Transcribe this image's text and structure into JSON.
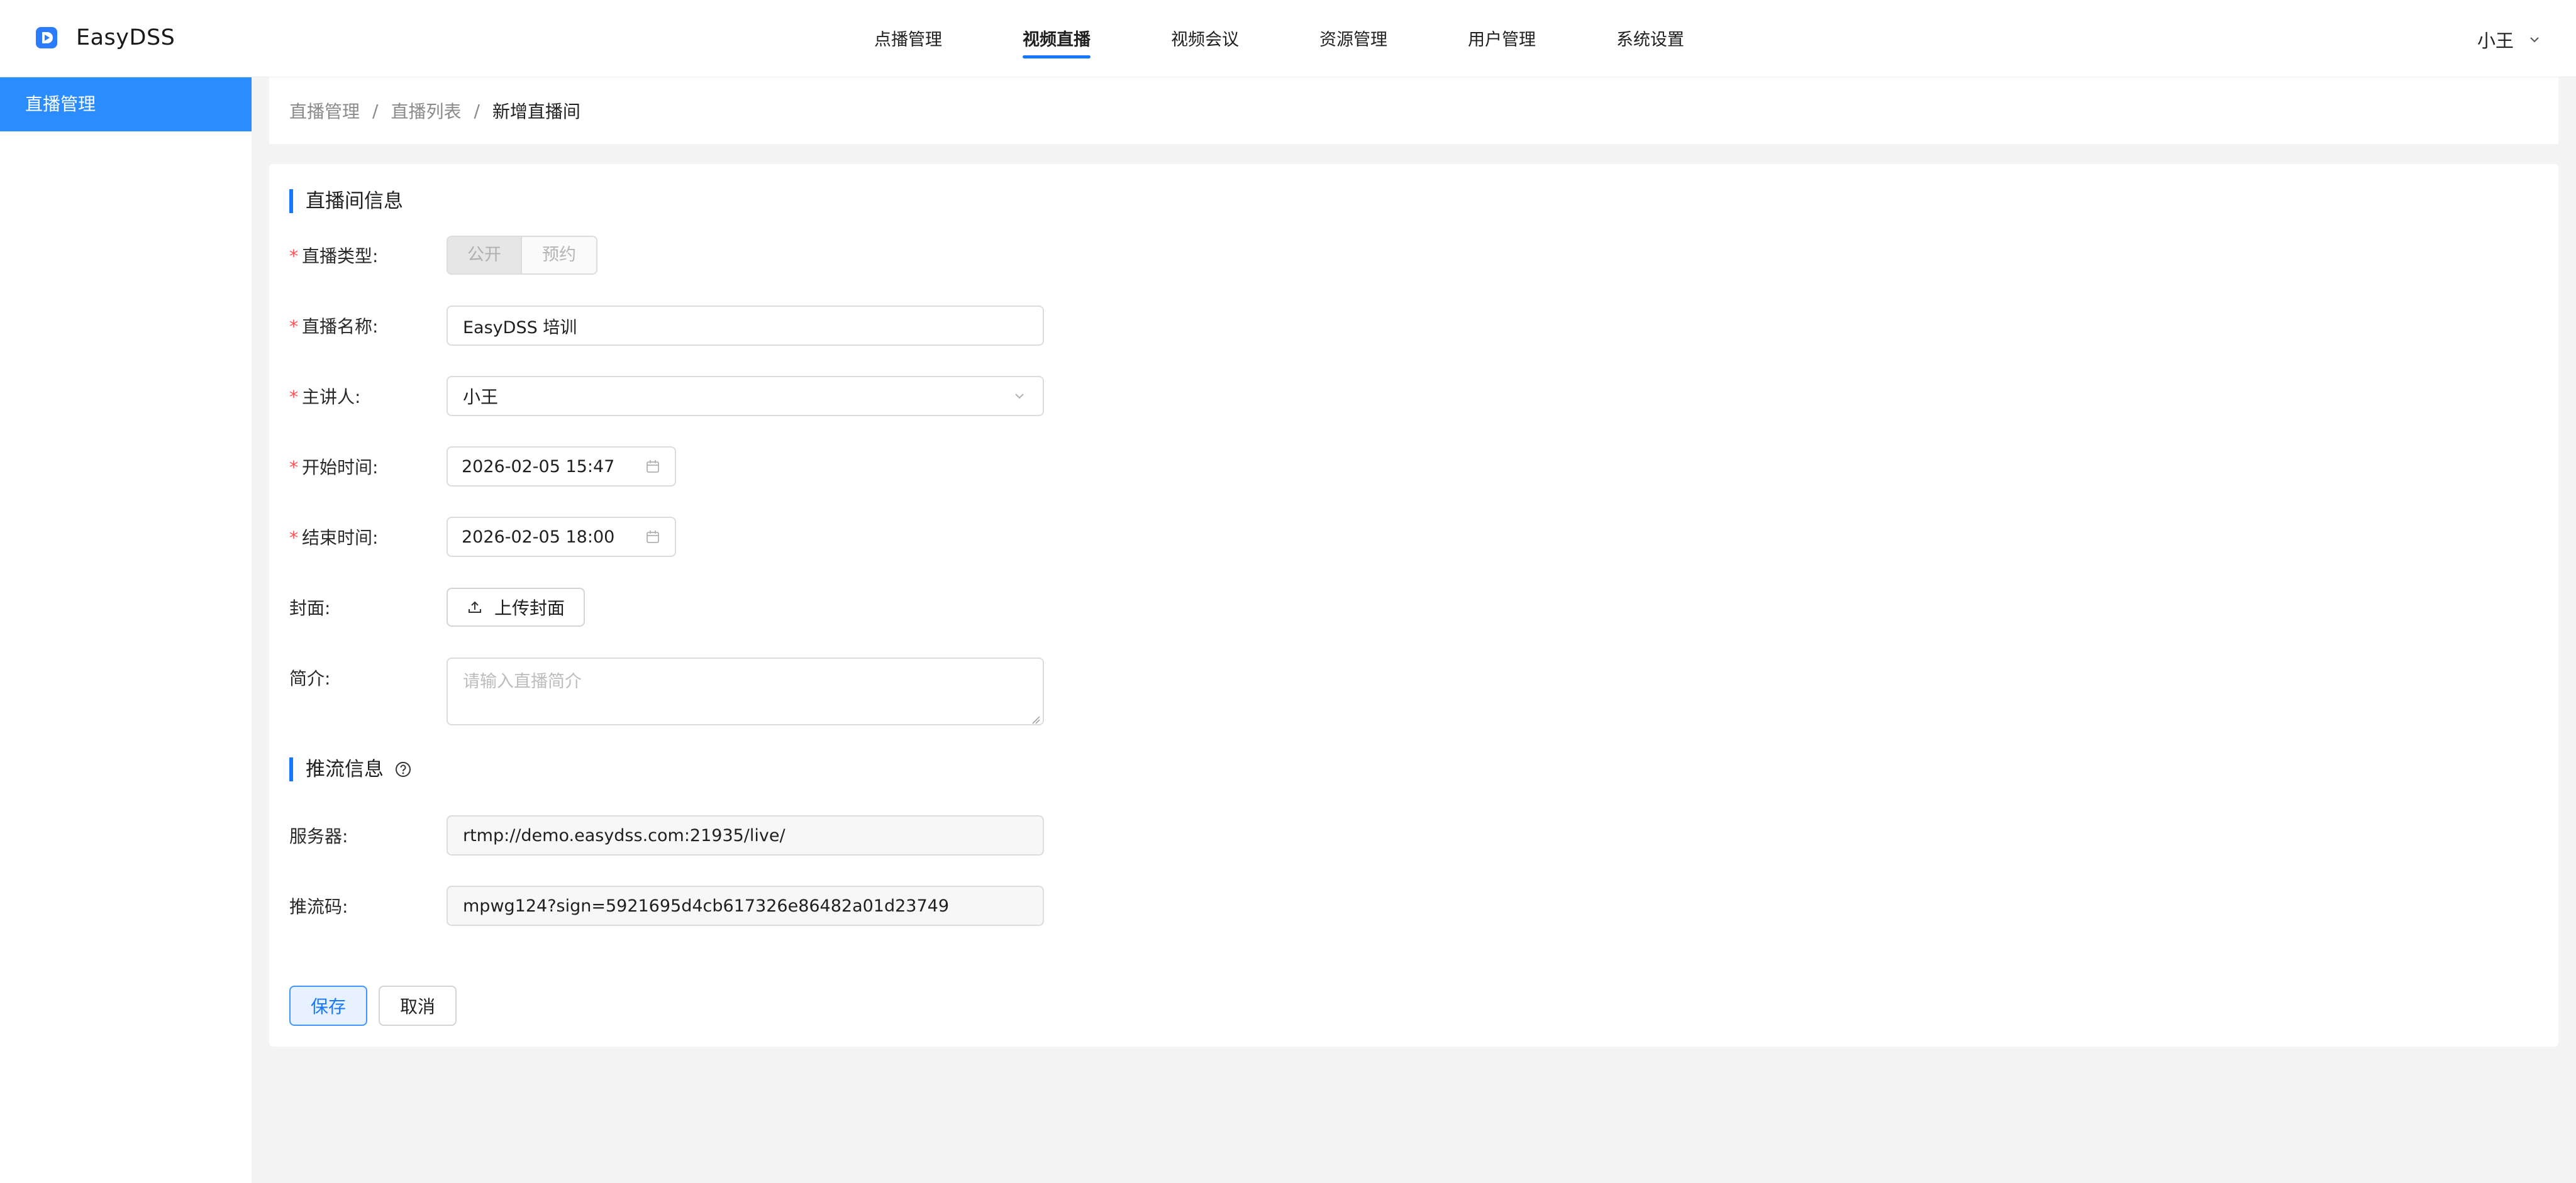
{
  "app": {
    "name": "EasyDSS"
  },
  "nav": {
    "items": [
      "点播管理",
      "视频直播",
      "视频会议",
      "资源管理",
      "用户管理",
      "系统设置"
    ],
    "active": "视频直播"
  },
  "user": {
    "name": "小王"
  },
  "sidebar": {
    "items": [
      {
        "label": "直播管理",
        "active": true
      }
    ]
  },
  "breadcrumb": {
    "items": [
      "直播管理",
      "直播列表"
    ],
    "current": "新增直播间",
    "separator": "/"
  },
  "form": {
    "section_room": "直播间信息",
    "live_type": {
      "label": "直播类型:",
      "options": [
        "公开",
        "预约"
      ],
      "selected": "公开"
    },
    "live_name": {
      "label": "直播名称:",
      "value": "EasyDSS 培训"
    },
    "speaker": {
      "label": "主讲人:",
      "value": "小王"
    },
    "start_time": {
      "label": "开始时间:",
      "value": "2026-02-05 15:47"
    },
    "end_time": {
      "label": "结束时间:",
      "value": "2026-02-05 18:00"
    },
    "cover": {
      "label": "封面:",
      "button": "上传封面"
    },
    "intro": {
      "label": "简介:",
      "placeholder": "请输入直播简介"
    },
    "section_push": "推流信息",
    "server": {
      "label": "服务器:",
      "value": "rtmp://demo.easydss.com:21935/live/"
    },
    "push_code": {
      "label": "推流码:",
      "value": "mpwg124?sign=5921695d4cb617326e86482a01d23749"
    },
    "save_label": "保存",
    "cancel_label": "取消"
  },
  "colors": {
    "accent": "#1677ff",
    "sidebar_active": "#2b8cff",
    "required": "#ff4d4f"
  }
}
